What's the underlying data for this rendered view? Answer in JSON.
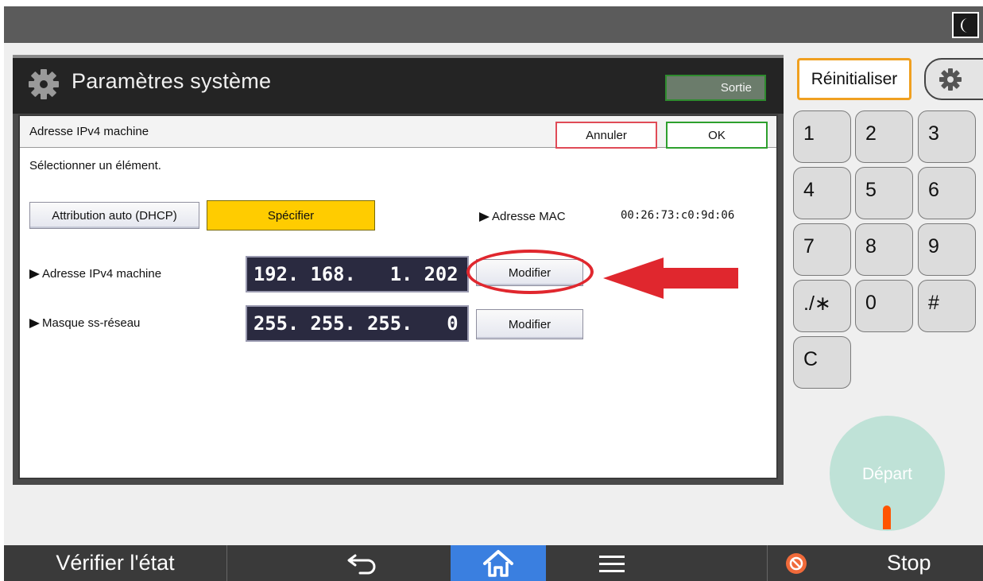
{
  "panel": {
    "title": "Paramètres système",
    "exit_label": "Sortie"
  },
  "dialog": {
    "title": "Adresse IPv4 machine",
    "cancel_label": "Annuler",
    "ok_label": "OK",
    "instruction": "Sélectionner un élément.",
    "dhcp_label": "Attribution auto (DHCP)",
    "specify_label": "Spécifier",
    "specify_selected": true,
    "mac_label": "Adresse MAC",
    "mac_value": "00:26:73:c0:9d:06",
    "ipv4_label": "Adresse IPv4 machine",
    "ipv4_value": "192. 168.   1. 202",
    "mask_label": "Masque ss-réseau",
    "mask_value": "255. 255. 255.   0",
    "modify_label": "Modifier"
  },
  "keypad": {
    "reset_label": "Réinitialiser",
    "keys": [
      "1",
      "2",
      "3",
      "4",
      "5",
      "6",
      "7",
      "8",
      "9",
      "./∗",
      "0",
      "#",
      "C"
    ],
    "start_label": "Départ"
  },
  "bottom_bar": {
    "check_status_label": "Vérifier l'état",
    "stop_label": "Stop",
    "icons": [
      "back-icon",
      "home-icon",
      "menu-icon",
      "stop-icon"
    ]
  },
  "colors": {
    "accent_yellow": "#ffcc00",
    "home_active": "#3a7fe0",
    "annotation_red": "#e0272e",
    "ok_green": "#2ea02e",
    "cancel_red": "#e04b57",
    "reset_orange": "#f0a020",
    "start_teal": "#bfe2d7"
  }
}
